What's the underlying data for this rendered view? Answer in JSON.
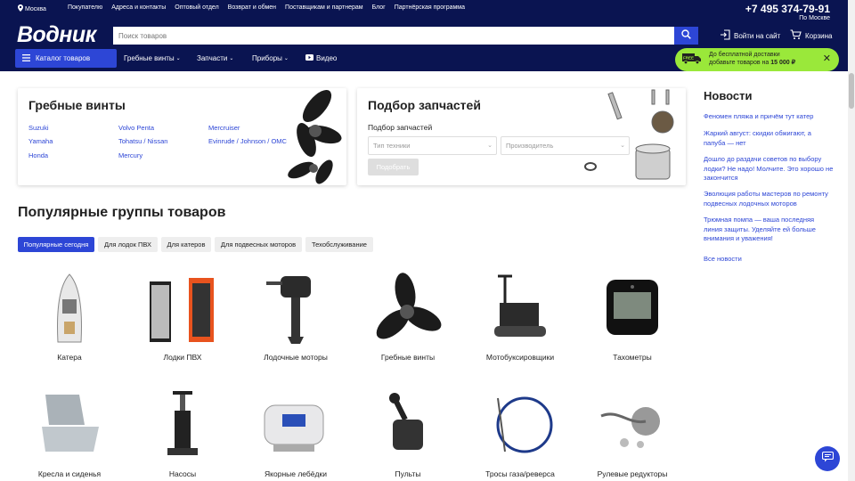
{
  "header": {
    "city": "Москва",
    "links": [
      "Покупателю",
      "Адреса и контакты",
      "Оптовый отдел",
      "Возврат и обмен",
      "Поставщикам и партнерам",
      "Блог",
      "Партнёрская программа"
    ],
    "phone": "+7 495 374-79-91",
    "region": "По Москве",
    "logo": "Водник",
    "search_placeholder": "Поиск товаров",
    "login": "Войти на сайт",
    "cart": "Корзина",
    "catalog": "Каталог товаров",
    "nav": [
      "Гребные винты",
      "Запчасти",
      "Приборы",
      "Видео"
    ]
  },
  "promo": {
    "badge": "FREE",
    "line1": "До бесплатной доставки",
    "line2_prefix": "добавьте товаров на ",
    "amount": "15 000 ₽"
  },
  "propellers": {
    "title": "Гребные винты",
    "brands": [
      "Suzuki",
      "Volvo Penta",
      "Mercruiser",
      "Yamaha",
      "Tohatsu / Nissan",
      "Evinrude / Johnson / OMC",
      "Honda",
      "Mercury"
    ]
  },
  "parts": {
    "title": "Подбор запчастей",
    "subtitle": "Подбор запчастей",
    "type_placeholder": "Тип техники",
    "maker_placeholder": "Производитель",
    "button": "Подобрать"
  },
  "news": {
    "title": "Новости",
    "items": [
      "Феномен пляжа и причём тут катер",
      "Жаркий август: скидки обжигают, а папуба — нет",
      "Дошло до раздачи советов по выбору лодки? Не надо! Молчите. Это хорошо не закончится",
      "Эволюция работы мастеров по ремонту подвесных лодочных моторов",
      "Трюмная помпа — ваша последняя линия защиты. Уделяйте ей больше внимания и уважения!"
    ],
    "all": "Все новости"
  },
  "popular": {
    "title": "Популярные группы товаров",
    "tabs": [
      "Популярные сегодня",
      "Для лодок ПВХ",
      "Для катеров",
      "Для подвесных моторов",
      "Техобслуживание"
    ],
    "row1": [
      "Катера",
      "Лодки ПВХ",
      "Лодочные моторы",
      "Гребные винты",
      "Мотобуксировщики",
      "Тахометры"
    ],
    "row2": [
      "Кресла и сиденья",
      "Насосы",
      "Якорные лебёдки",
      "Пульты",
      "Тросы газа/реверса",
      "Рулевые редукторы"
    ]
  },
  "colors": {
    "header": "#0a1451",
    "accent": "#2d46d6",
    "promo": "#9ae83a"
  }
}
